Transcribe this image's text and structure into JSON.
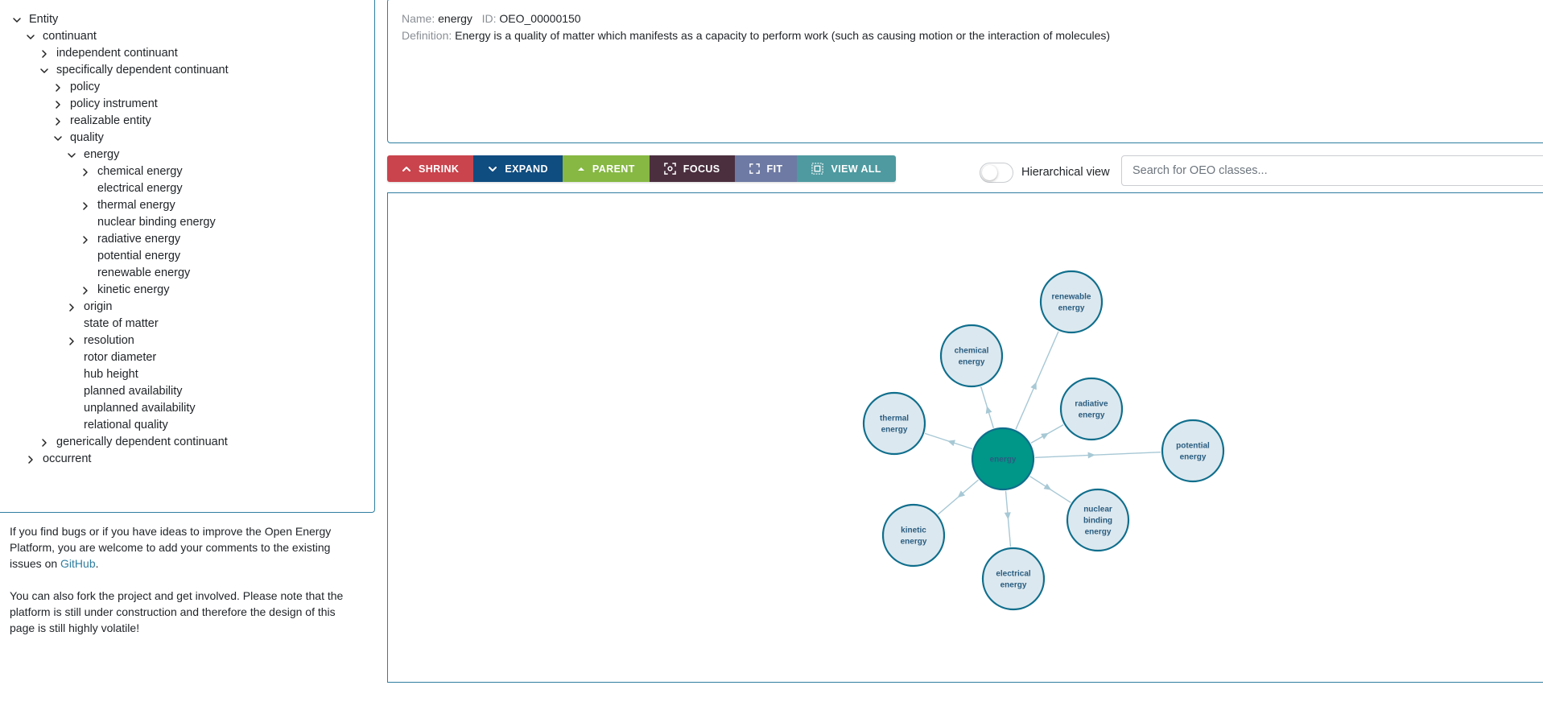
{
  "tree": {
    "items": [
      {
        "label": "Entity",
        "level": 0,
        "state": "expanded"
      },
      {
        "label": "continuant",
        "level": 1,
        "state": "expanded"
      },
      {
        "label": "independent continuant",
        "level": 2,
        "state": "collapsed"
      },
      {
        "label": "specifically dependent continuant",
        "level": 2,
        "state": "expanded"
      },
      {
        "label": "policy",
        "level": 3,
        "state": "collapsed"
      },
      {
        "label": "policy instrument",
        "level": 3,
        "state": "collapsed"
      },
      {
        "label": "realizable entity",
        "level": 3,
        "state": "collapsed"
      },
      {
        "label": "quality",
        "level": 3,
        "state": "expanded"
      },
      {
        "label": "energy",
        "level": 4,
        "state": "expanded"
      },
      {
        "label": "chemical energy",
        "level": 5,
        "state": "collapsed"
      },
      {
        "label": "electrical energy",
        "level": 5,
        "state": "leaf"
      },
      {
        "label": "thermal energy",
        "level": 5,
        "state": "collapsed"
      },
      {
        "label": "nuclear binding energy",
        "level": 5,
        "state": "leaf"
      },
      {
        "label": "radiative energy",
        "level": 5,
        "state": "collapsed"
      },
      {
        "label": "potential energy",
        "level": 5,
        "state": "leaf"
      },
      {
        "label": "renewable energy",
        "level": 5,
        "state": "leaf"
      },
      {
        "label": "kinetic energy",
        "level": 5,
        "state": "collapsed"
      },
      {
        "label": "origin",
        "level": 4,
        "state": "collapsed"
      },
      {
        "label": "state of matter",
        "level": 4,
        "state": "leaf"
      },
      {
        "label": "resolution",
        "level": 4,
        "state": "collapsed"
      },
      {
        "label": "rotor diameter",
        "level": 4,
        "state": "leaf"
      },
      {
        "label": "hub height",
        "level": 4,
        "state": "leaf"
      },
      {
        "label": "planned availability",
        "level": 4,
        "state": "leaf"
      },
      {
        "label": "unplanned availability",
        "level": 4,
        "state": "leaf"
      },
      {
        "label": "relational quality",
        "level": 4,
        "state": "leaf"
      },
      {
        "label": "generically dependent continuant",
        "level": 2,
        "state": "collapsed"
      },
      {
        "label": "occurrent",
        "level": 1,
        "state": "collapsed"
      }
    ]
  },
  "info": {
    "p1_before_link": "If you find bugs or if you have ideas to improve the Open Energy Platform, you are welcome to add your comments to the existing issues on ",
    "p1_link": "GitHub",
    "p1_after_link": ".",
    "p2": "You can also fork the project and get involved. Please note that the platform is still under construction and therefore the design of this page is still highly volatile!"
  },
  "definition": {
    "name_label": "Name:",
    "name_value": "energy",
    "id_label": "ID:",
    "id_value": "OEO_00000150",
    "definition_label": "Definition:",
    "definition_value": "Energy is a quality of matter which manifests as a capacity to perform work (such as causing motion or the interaction of molecules)"
  },
  "toolbar": {
    "buttons": [
      {
        "key": "shrink",
        "label": "SHRINK",
        "color": "#c9444d",
        "icon": "chevron-up-icon"
      },
      {
        "key": "expand",
        "label": "EXPAND",
        "color": "#0f4c80",
        "icon": "chevron-down-icon"
      },
      {
        "key": "parent",
        "label": "PARENT",
        "color": "#86b843",
        "icon": "caret-up-icon"
      },
      {
        "key": "focus",
        "label": "FOCUS",
        "color": "#4b2f3f",
        "icon": "focus-icon"
      },
      {
        "key": "fit",
        "label": "FIT",
        "color": "#6e7aa3",
        "icon": "fit-icon"
      },
      {
        "key": "view_all",
        "label": "VIEW ALL",
        "color": "#4e9aa0",
        "icon": "view-all-icon"
      }
    ]
  },
  "view_toggle": {
    "label": "Hierarchical view",
    "checked": false
  },
  "search": {
    "placeholder": "Search for OEO classes...",
    "value": ""
  },
  "graph": {
    "colors": {
      "center_fill": "#009688",
      "node_fill": "#dce8ef",
      "node_stroke": "#0f6e8c",
      "edge": "#a7c8d5"
    },
    "center": {
      "id": "energy",
      "lines": [
        "energy"
      ]
    },
    "nodes": [
      {
        "id": "renewable",
        "lines": [
          "renewable",
          "energy"
        ]
      },
      {
        "id": "chemical",
        "lines": [
          "chemical",
          "energy"
        ]
      },
      {
        "id": "radiative",
        "lines": [
          "radiative",
          "energy"
        ]
      },
      {
        "id": "thermal",
        "lines": [
          "thermal",
          "energy"
        ]
      },
      {
        "id": "potential",
        "lines": [
          "potential",
          "energy"
        ]
      },
      {
        "id": "kinetic",
        "lines": [
          "kinetic",
          "energy"
        ]
      },
      {
        "id": "nuclear",
        "lines": [
          "nuclear",
          "binding",
          "energy"
        ]
      },
      {
        "id": "electrical",
        "lines": [
          "electrical",
          "energy"
        ]
      }
    ]
  }
}
